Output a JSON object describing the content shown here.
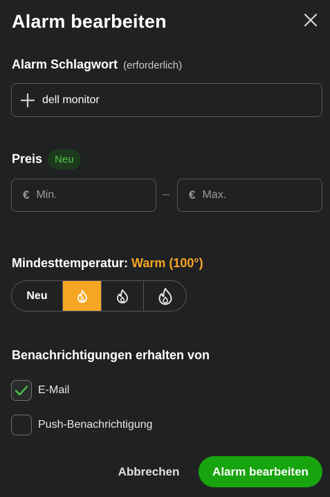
{
  "dialog": {
    "title": "Alarm bearbeiten"
  },
  "keyword": {
    "label": "Alarm Schlagwort",
    "hint": "(erforderlich)",
    "value": "dell monitor"
  },
  "price": {
    "label": "Preis",
    "badge": "Neu",
    "currency_symbol": "€",
    "min_placeholder": "Min.",
    "max_placeholder": "Max.",
    "separator": "–"
  },
  "temperature": {
    "label": "Mindesttemperatur:",
    "value": "Warm (100°)",
    "options": [
      {
        "label": "Neu",
        "icon": "text",
        "selected": false
      },
      {
        "label": "",
        "icon": "flame-small-icon",
        "selected": true
      },
      {
        "label": "",
        "icon": "flame-medium-icon",
        "selected": false
      },
      {
        "label": "",
        "icon": "flame-large-icon",
        "selected": false
      }
    ]
  },
  "notifications": {
    "label": "Benachrichtigungen erhalten von",
    "email": {
      "label": "E-Mail",
      "checked": true
    },
    "push": {
      "label": "Push-Benachrichtigung",
      "checked": false
    }
  },
  "actions": {
    "cancel_label": "Abbrechen",
    "submit_label": "Alarm bearbeiten"
  },
  "colors": {
    "background": "#202123",
    "accent_orange": "#f5a623",
    "primary_green": "#18a40f",
    "badge_green": "#4fc84a"
  }
}
